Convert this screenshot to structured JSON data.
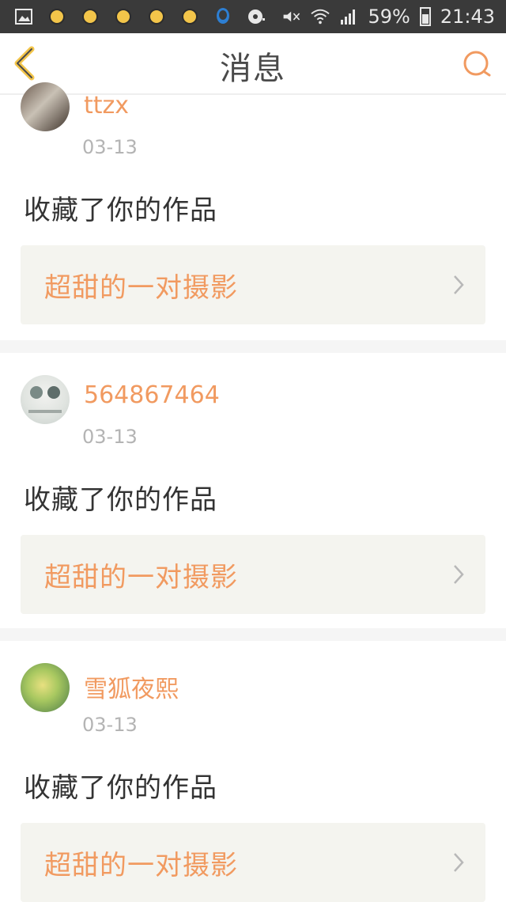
{
  "status_bar": {
    "battery": "59%",
    "time": "21:43",
    "icons": [
      "gallery-icon",
      "notification-icon",
      "notification-icon",
      "notification-icon",
      "notification-icon",
      "notification-icon",
      "qq-icon",
      "disc-icon",
      "mute-icon",
      "wifi-icon",
      "signal-icon",
      "battery-icon"
    ]
  },
  "header": {
    "title": "消息",
    "back_icon": "back-chevron-icon",
    "search_icon": "search-icon"
  },
  "messages": [
    {
      "username": "ttzx",
      "date": "03-13",
      "action": "收藏了你的作品",
      "work_title": "超甜的一对摄影"
    },
    {
      "username": "564867464",
      "date": "03-13",
      "action": "收藏了你的作品",
      "work_title": "超甜的一对摄影"
    },
    {
      "username": "雪狐夜熙",
      "date": "03-13",
      "action": "收藏了你的作品",
      "work_title": "超甜的一对摄影"
    }
  ],
  "colors": {
    "accent": "#f19a60",
    "statusbar_bg": "#3a3a3a",
    "card_box_bg": "#f4f4ef",
    "separator": "#f5f5f5"
  }
}
